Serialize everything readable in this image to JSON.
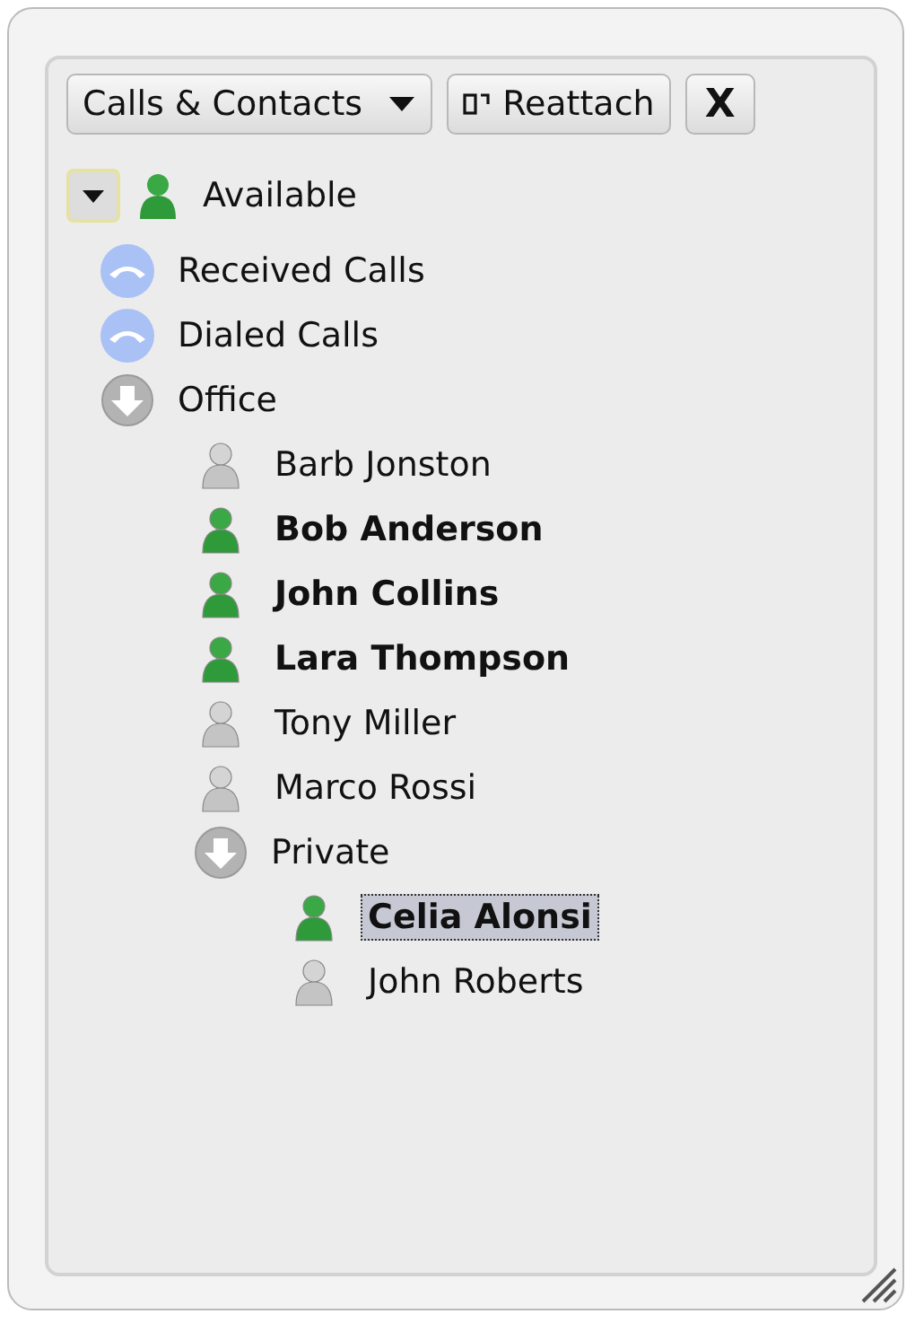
{
  "toolbar": {
    "view_menu": "Calls & Contacts",
    "reattach_button": "Reattach",
    "close_button": "X"
  },
  "status": {
    "label": "Available",
    "online": true
  },
  "tree": [
    {
      "kind": "call",
      "label": "Received Calls",
      "selected": false
    },
    {
      "kind": "call",
      "label": "Dialed Calls",
      "selected": false
    },
    {
      "kind": "group",
      "label": "Office",
      "expanded": true,
      "selected": false,
      "children": [
        {
          "kind": "contact",
          "label": "Barb Jonston",
          "online": false,
          "selected": false
        },
        {
          "kind": "contact",
          "label": "Bob Anderson",
          "online": true,
          "selected": false
        },
        {
          "kind": "contact",
          "label": "John Collins",
          "online": true,
          "selected": false
        },
        {
          "kind": "contact",
          "label": "Lara Thompson",
          "online": true,
          "selected": false
        },
        {
          "kind": "contact",
          "label": "Tony Miller",
          "online": false,
          "selected": false
        },
        {
          "kind": "contact",
          "label": "Marco Rossi",
          "online": false,
          "selected": false
        },
        {
          "kind": "group",
          "label": "Private",
          "expanded": true,
          "selected": false,
          "children": [
            {
              "kind": "contact",
              "label": "Celia Alonsi",
              "online": true,
              "selected": true
            },
            {
              "kind": "contact",
              "label": "John Roberts",
              "online": false,
              "selected": false
            }
          ]
        }
      ]
    }
  ]
}
